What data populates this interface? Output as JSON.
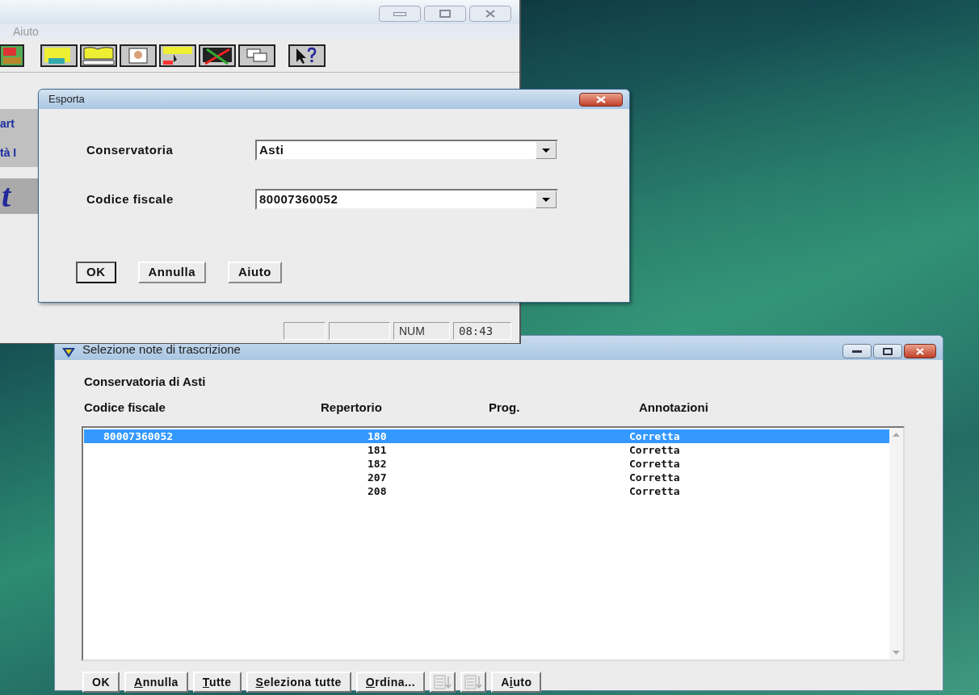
{
  "main_window": {
    "menu": [
      "Aiuto"
    ],
    "side_fragments": [
      "art",
      "tà I",
      "t"
    ],
    "status_bar": [
      "NUM",
      "08:43"
    ]
  },
  "export_dialog": {
    "title": "Esporta",
    "fields": [
      {
        "label": "Conservatoria",
        "value": "Asti"
      },
      {
        "label": "Codice fiscale",
        "value": "80007360052"
      }
    ],
    "buttons": [
      {
        "label": "OK",
        "default": true
      },
      {
        "label": "Annulla",
        "default": false
      },
      {
        "label": "Aiuto",
        "default": false
      }
    ]
  },
  "selection_window": {
    "title": "Selezione note di trascrizione",
    "subtitle": "Conservatoria di  Asti",
    "columns": [
      "Codice fiscale",
      "Repertorio",
      "Prog.",
      "Annotazioni"
    ],
    "rows": [
      {
        "codice_fiscale": "80007360052",
        "repertorio": "180",
        "annotazioni": "Corretta",
        "selected": true
      },
      {
        "repertorio": "181",
        "annotazioni": "Corretta",
        "selected": false
      },
      {
        "repertorio": "182",
        "annotazioni": "Corretta",
        "selected": false
      },
      {
        "repertorio": "207",
        "annotazioni": "Corretta",
        "selected": false
      },
      {
        "repertorio": "208",
        "annotazioni": "Corretta",
        "selected": false
      }
    ],
    "buttons": [
      {
        "kind": "text",
        "label": "OK"
      },
      {
        "kind": "text",
        "label_parts": [
          {
            "text": "A",
            "underlined": true
          },
          {
            "text": "nnulla",
            "underlined": false
          }
        ]
      },
      {
        "kind": "text",
        "label_parts": [
          {
            "text": "T",
            "underlined": true
          },
          {
            "text": "utte",
            "underlined": false
          }
        ]
      },
      {
        "kind": "text",
        "label_parts": [
          {
            "text": "S",
            "underlined": true
          },
          {
            "text": "eleziona tutte",
            "underlined": false
          }
        ]
      },
      {
        "kind": "text",
        "label_parts": [
          {
            "text": "O",
            "underlined": true
          },
          {
            "text": "rdina...",
            "underlined": false
          }
        ]
      },
      {
        "kind": "icon",
        "disabled": true
      },
      {
        "kind": "icon",
        "disabled": true
      },
      {
        "kind": "text",
        "label_parts": [
          {
            "text": "A",
            "underlined": false
          },
          {
            "text": "i",
            "underlined": true
          },
          {
            "text": "uto",
            "underlined": false
          }
        ]
      }
    ]
  }
}
